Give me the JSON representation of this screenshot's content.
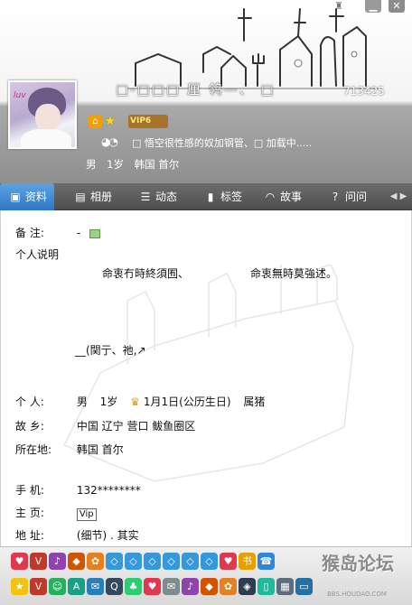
{
  "header": {
    "name_line": "□-□□□ 厘  鸰—、 □",
    "qq_number": "713425",
    "vip_label": "VIP6",
    "mood_text": "□ 悟空很性感的奴加钢管、□  加载中.....",
    "gender": "男",
    "age": "1岁",
    "location": "韩国 首尔"
  },
  "tabs": [
    {
      "label": "资料",
      "icon": "profile-card-icon",
      "active": true
    },
    {
      "label": "相册",
      "icon": "photo-icon",
      "active": false
    },
    {
      "label": "动态",
      "icon": "list-icon",
      "active": false
    },
    {
      "label": "标签",
      "icon": "bookmark-icon",
      "active": false
    },
    {
      "label": "故事",
      "icon": "wifi-icon",
      "active": false
    },
    {
      "label": "问问",
      "icon": "question-icon",
      "active": false
    }
  ],
  "profile": {
    "remark_label": "备    注:",
    "remark_value": "-",
    "description_label": "个人说明",
    "description_line1a": "命衷冇時終須囿、",
    "description_line1b": "命衷無時莫強述。",
    "description_line2": "__(関亍、祂,↗",
    "personal_label": "个    人:",
    "personal_gender": "男",
    "personal_age": "1岁",
    "birthday": "1月1日(公历生日)",
    "zodiac": "属猪",
    "hometown_label": "故    乡:",
    "hometown_value": "中国 辽宁 营口 鲅鱼圈区",
    "current_label": "所在地:",
    "current_value": "韩国 首尔",
    "phone_label": "手    机:",
    "phone_value": "132********",
    "homepage_label": "主    页:",
    "homepage_value": "Vip",
    "address_label": "地    址:",
    "address_value": "(细节)    .        其实"
  },
  "toolbar": {
    "row1": [
      "heart-icon",
      "vip-icon",
      "music-icon",
      "game-icon",
      "pet-icon",
      "diamond-icon",
      "diamond-icon",
      "diamond-icon",
      "diamond-icon",
      "diamond-icon",
      "diamond-icon",
      "heart-icon",
      "book-icon",
      "phone-icon"
    ],
    "row2": [
      "star-icon",
      "vip-icon",
      "smile-icon",
      "app-icon",
      "chat-icon",
      "qq-icon",
      "clover-icon",
      "heart-icon",
      "mail-icon",
      "music-icon",
      "game-icon",
      "pet-icon",
      "shield-icon",
      "mobile-icon",
      "grid-icon",
      "card-icon"
    ],
    "watermark": "猴岛论坛",
    "watermark_url": "BBS.HOUDAO.COM"
  }
}
